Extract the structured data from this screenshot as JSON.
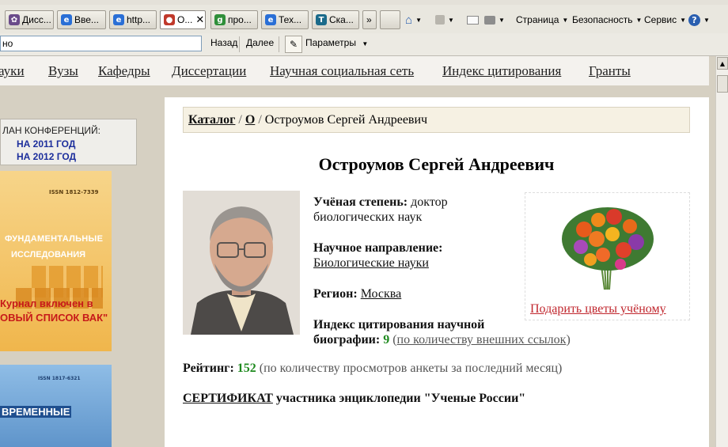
{
  "browser": {
    "tabs": [
      {
        "label": "Дисс...",
        "icon_color": "#6a4b8a"
      },
      {
        "label": "Вве...",
        "icon_color": "#2a6fd6"
      },
      {
        "label": "http...",
        "icon_color": "#2a6fd6"
      },
      {
        "label": "О...",
        "icon_color": "#c0392b",
        "active": true
      },
      {
        "label": "про...",
        "icon_color": "#2f8f3a"
      },
      {
        "label": "Тех...",
        "icon_color": "#2a6fd6"
      },
      {
        "label": "Ска...",
        "icon_color": "#1a6a8a"
      }
    ],
    "tab_overflow": "»",
    "close_glyph": "✕",
    "commands": {
      "page": "Страница",
      "security": "Безопасность",
      "service": "Сервис"
    },
    "address_value": "но",
    "back": "Назад",
    "forward": "Далее",
    "params": "Параметры"
  },
  "site_nav": [
    "ауки",
    "Вузы",
    "Кафедры",
    "Диссертации",
    "Научная социальная сеть",
    "Индекс цитирования",
    "Гранты"
  ],
  "sidebar": {
    "conf_title": "ЛАН КОНФЕРЕНЦИЙ:",
    "conf_links": [
      "НА 2011 ГОД",
      "НА 2012 ГОД"
    ],
    "banner1": {
      "issn": "ISSN 1812-7339",
      "line1": "ФУНДАМЕНТАЛЬНЫЕ",
      "line2": "ИССЛЕДОВАНИЯ",
      "line3": "Курнал включен в",
      "line4": "ОВЫЙ СПИСОК ВАК\""
    },
    "banner2": {
      "issn": "ISSN 1817-6321",
      "text": "ВРЕМЕННЫЕ"
    }
  },
  "breadcrumb": {
    "catalog": "Каталог",
    "sep": "/",
    "letter": "О",
    "current": "Остроумов Сергей Андреевич"
  },
  "profile": {
    "name": "Остроумов Сергей Андреевич",
    "degree_label": "Учёная степень:",
    "degree_value_1": "доктор",
    "degree_value_2": "биологических наук",
    "direction_label": "Научное направление:",
    "direction_value": "Биологические науки",
    "region_label": "Регион:",
    "region_value": "Москва",
    "citation_label_1": "Индекс цитирования научной",
    "citation_label_2": "биографии:",
    "citation_value": "9",
    "citation_note_open": "(",
    "citation_note_link": "по количеству внешних ссылок",
    "citation_note_close": ")",
    "gift_link": "Подарить цветы учёному",
    "rating_label": "Рейтинг:",
    "rating_value": "152",
    "rating_note": "(по количеству просмотров анкеты за последний месяц)",
    "cert_link": "СЕРТИФИКАТ",
    "cert_text": "участника энциклопедии \"Ученые России\""
  }
}
